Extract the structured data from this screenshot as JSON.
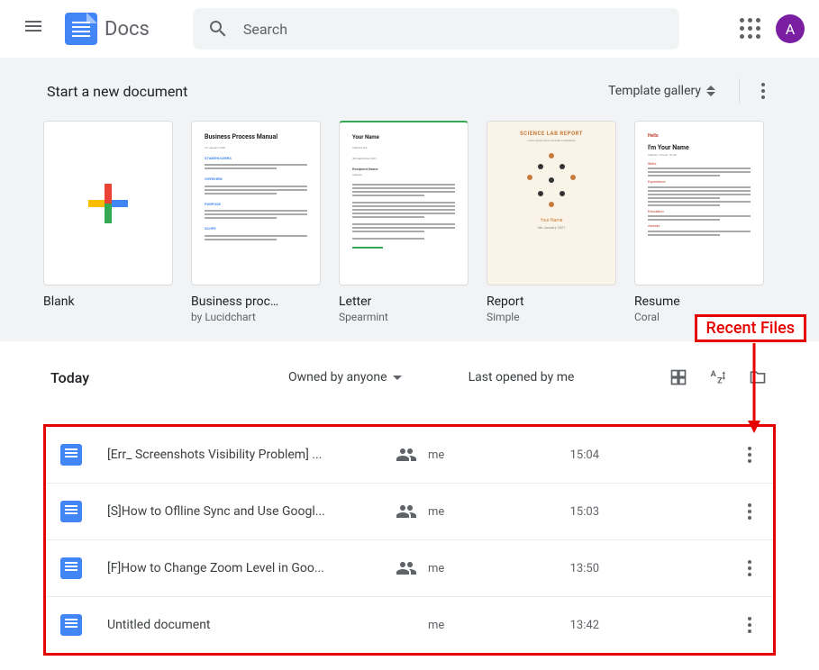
{
  "header": {
    "app_name": "Docs",
    "search_placeholder": "Search",
    "avatar_letter": "A"
  },
  "templates": {
    "section_title": "Start a new document",
    "gallery_label": "Template gallery",
    "cards": [
      {
        "name": "Blank",
        "sub": ""
      },
      {
        "name": "Business proc…",
        "sub": "by Lucidchart",
        "thumb_title": "Business Process Manual"
      },
      {
        "name": "Letter",
        "sub": "Spearmint"
      },
      {
        "name": "Report",
        "sub": "Simple",
        "thumb_title": "SCIENCE LAB REPORT",
        "thumb_author": "Your Name"
      },
      {
        "name": "Resume",
        "sub": "Coral",
        "thumb_title": "Your Name"
      }
    ]
  },
  "annotation": {
    "label": "Recent Files"
  },
  "recent": {
    "group_label": "Today",
    "owner_filter": "Owned by anyone",
    "sort_label": "Last opened by me",
    "files": [
      {
        "name": "[Err_ Screenshots Visibility Problem] ...",
        "owner": "me",
        "time": "15:04",
        "shared": true
      },
      {
        "name": "[S]How to Oflline Sync and Use Googl...",
        "owner": "me",
        "time": "15:03",
        "shared": true
      },
      {
        "name": "[F]How to Change Zoom Level in Goo...",
        "owner": "me",
        "time": "13:50",
        "shared": true
      },
      {
        "name": "Untitled document",
        "owner": "me",
        "time": "13:42",
        "shared": false
      }
    ]
  }
}
